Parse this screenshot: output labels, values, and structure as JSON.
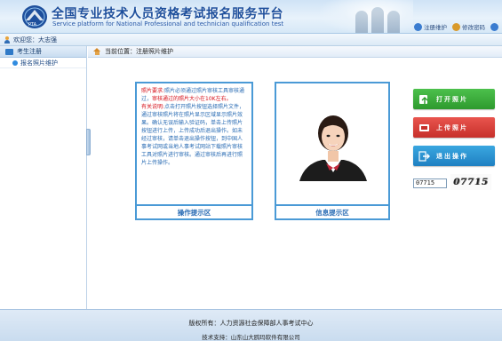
{
  "header": {
    "title": "全国专业技术人员资格考试报名服务平台",
    "subtitle": "Service platform for National Professional and technician qualification test",
    "links": [
      {
        "label": "注册维护",
        "icon": "register-icon",
        "color": "#3a7cd0"
      },
      {
        "label": "修改密码",
        "icon": "key-icon",
        "color": "#d99a2b"
      },
      {
        "label": "",
        "icon": "help-icon",
        "color": "#3a7cd0"
      }
    ]
  },
  "welcome": {
    "text": "欢迎您：大志强"
  },
  "sidebar": {
    "heading": "考生注册",
    "items": [
      {
        "label": "报名照片维护"
      }
    ]
  },
  "breadcrumb": {
    "text": "当前位置：注册照片维护"
  },
  "tips": {
    "req_label": "照片要求:",
    "req_text_a": "照片必须通过照片审核工具审核通过，",
    "req_text_b": "审核通过的照片大小在10K左右。",
    "desc_label": "有关说明:",
    "desc_text": "点击打开照片按钮选择照片文件，通过审核照片将在照片显示区域显示照片效果。确认无误后输入验证码，单击上传照片按钮进行上传，上传成功后退出操作。如未经过审核，请单击退出操作按钮，到中国人事考试网或当地人事考试网站下载照片审核工具对照片进行审核。通过审核后再进行照片上传操作。",
    "footer": "操作提示区"
  },
  "photo_panel": {
    "footer": "信息提示区"
  },
  "buttons": {
    "open": "打开照片",
    "upload": "上传照片",
    "exit": "退出操作"
  },
  "captcha": {
    "input_value": "07715",
    "image_text": "07715"
  },
  "footer": {
    "copyright": "版权所有：人力资源社会保障部人事考试中心",
    "support": "技术支持：山东山大鸥玛软件有限公司"
  },
  "colors": {
    "header_blue": "#1e4f9c",
    "panel_border": "#4a9ad6",
    "open_green": "#2e9a2e",
    "upload_red": "#c7302b",
    "exit_blue": "#1f80c2",
    "tip_red": "#d6101a"
  }
}
